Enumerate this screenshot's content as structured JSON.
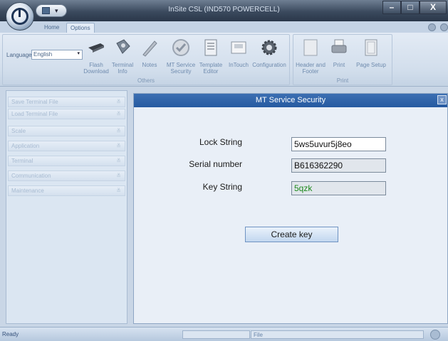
{
  "window": {
    "title": "InSite CSL (IND570 POWERCELL)",
    "minimize_glyph": "–",
    "maximize_glyph": "□",
    "close_glyph": "X"
  },
  "quick_access": {
    "dropdown_glyph": "▾"
  },
  "tabs": [
    {
      "label": "Home"
    },
    {
      "label": "Options"
    }
  ],
  "ribbon": {
    "language_label": "Language",
    "language_value": "English",
    "buttons": [
      {
        "label": "Flash Download",
        "icon": "flash-download-icon"
      },
      {
        "label": "Terminal Info",
        "icon": "terminal-info-icon"
      },
      {
        "label": "Notes",
        "icon": "pencil-icon"
      },
      {
        "label": "MT Service Security",
        "icon": "security-check-icon"
      },
      {
        "label": "Template Editor",
        "icon": "template-editor-icon"
      },
      {
        "label": "InTouch",
        "icon": "intouch-icon"
      },
      {
        "label": "Configuration",
        "icon": "gear-icon"
      },
      {
        "label": "Header and Footer",
        "icon": "header-footer-icon"
      },
      {
        "label": "Print",
        "icon": "printer-icon"
      },
      {
        "label": "Page Setup",
        "icon": "page-setup-icon"
      }
    ],
    "groups": {
      "others": "Others",
      "print": "Print"
    }
  },
  "sidebar": {
    "items": [
      {
        "label": "Save Terminal File"
      },
      {
        "label": "Load Terminal File"
      },
      {
        "label": "Scale"
      },
      {
        "label": "Application"
      },
      {
        "label": "Terminal"
      },
      {
        "label": "Communication"
      },
      {
        "label": "Maintenance"
      }
    ]
  },
  "panel": {
    "title": "MT Service Security",
    "close_glyph": "x",
    "lock_label": "Lock String",
    "lock_value": "5ws5uvur5j8eo",
    "serial_label": "Serial number",
    "serial_value": "B616362290",
    "key_label": "Key String",
    "key_value": "5qzk",
    "create_button": "Create key"
  },
  "status": {
    "ready": "Ready",
    "file": "File"
  },
  "colors": {
    "accent": "#2a5ea5",
    "key_text": "#1d8a1d"
  }
}
